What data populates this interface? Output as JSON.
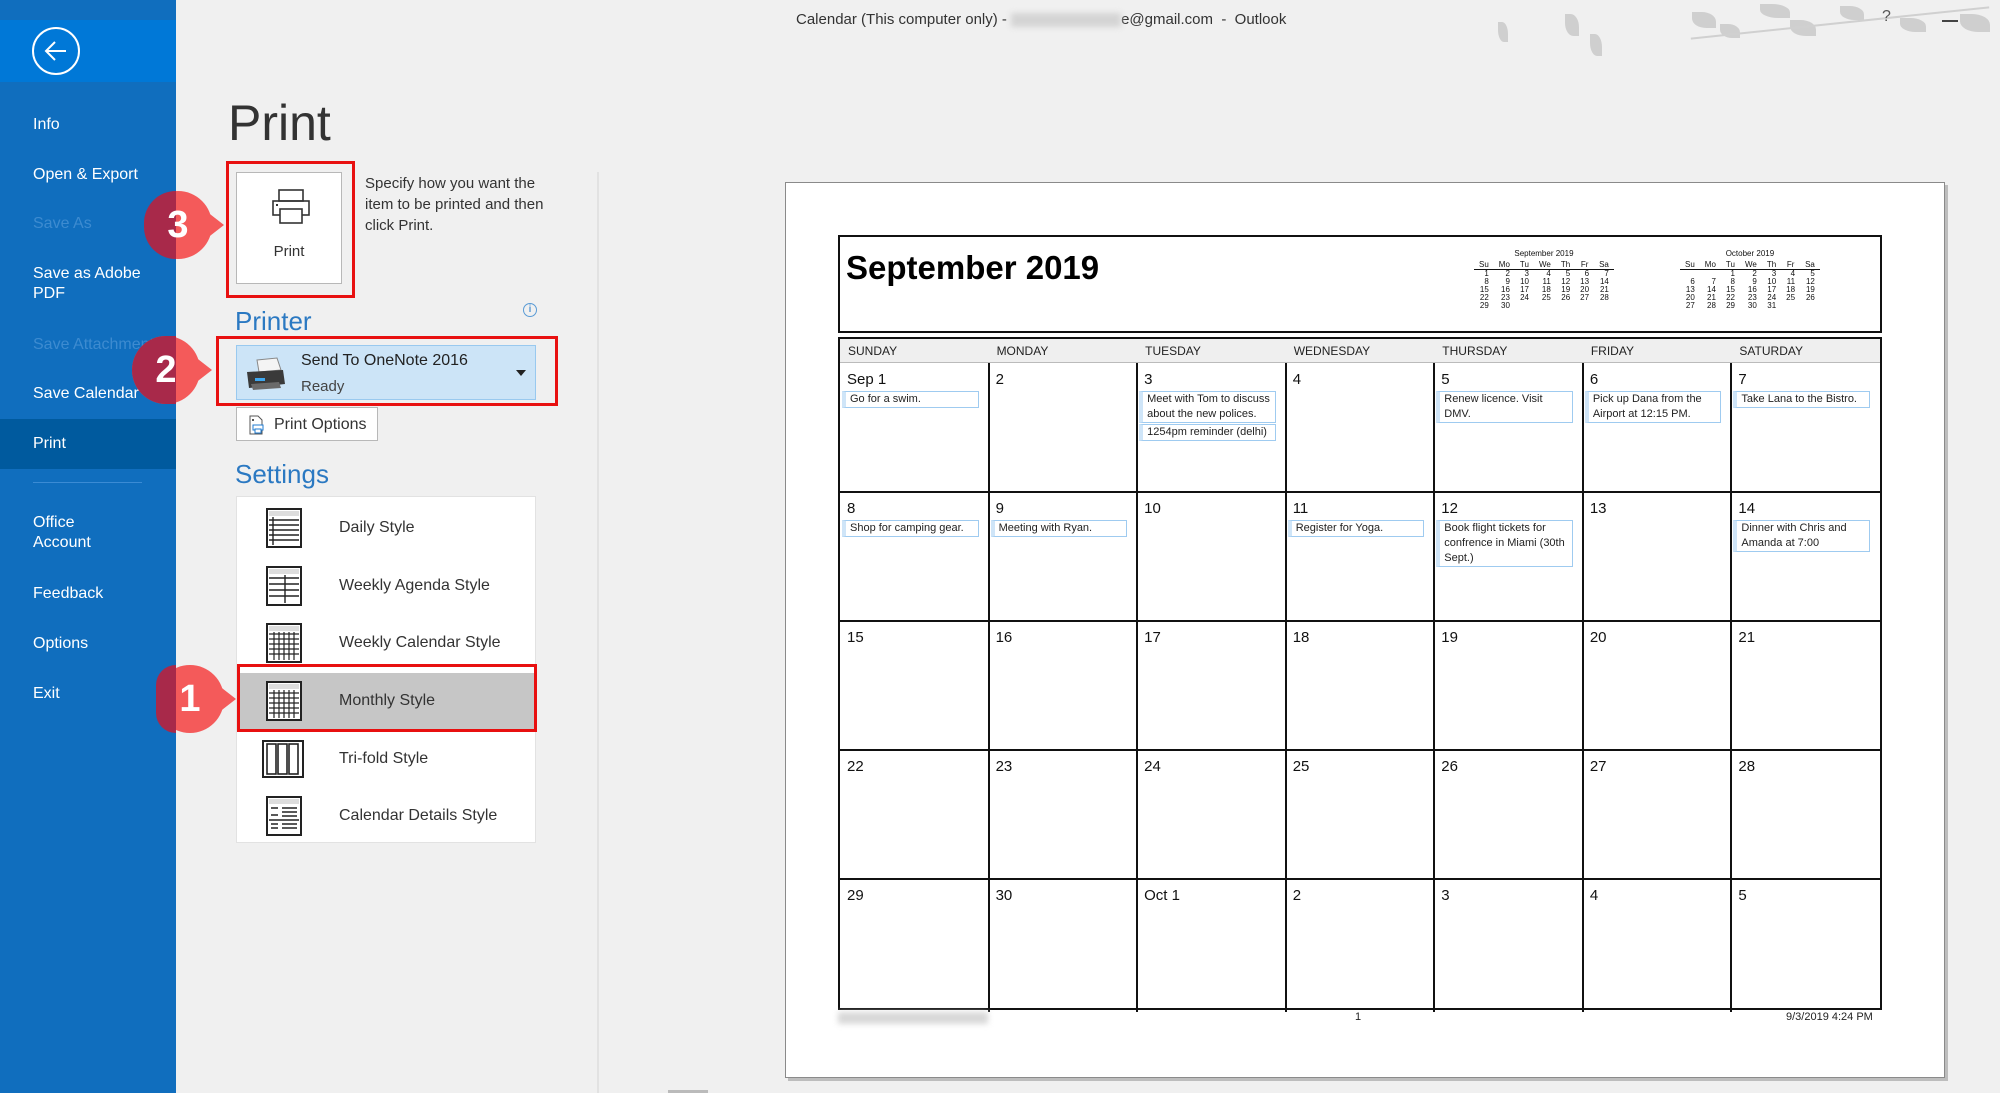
{
  "window": {
    "title_prefix": "Calendar (This computer only) - ",
    "title_email_visible": "e@gmail.com",
    "title_app": "  -  Outlook",
    "help_label": "?"
  },
  "sidebar": {
    "items": [
      {
        "label": "Info",
        "state": "normal"
      },
      {
        "label": "Open & Export",
        "state": "normal"
      },
      {
        "label": "Save As",
        "state": "disabled"
      },
      {
        "label": "Save as Adobe PDF",
        "state": "normal"
      },
      {
        "label": "Save Attachments",
        "state": "disabled"
      },
      {
        "label": "Save Calendar",
        "state": "normal"
      },
      {
        "label": "Print",
        "state": "active"
      },
      {
        "label": "Office Account",
        "state": "normal"
      },
      {
        "label": "Feedback",
        "state": "normal"
      },
      {
        "label": "Options",
        "state": "normal"
      },
      {
        "label": "Exit",
        "state": "normal"
      }
    ]
  },
  "print_panel": {
    "title": "Print",
    "print_button_label": "Print",
    "description": "Specify how you want the item to be printed and then click Print.",
    "printer_heading": "Printer",
    "printer_name": "Send To OneNote 2016",
    "printer_status": "Ready",
    "print_options_label": "Print Options",
    "settings_heading": "Settings",
    "styles": [
      {
        "label": "Daily Style",
        "icon": "daily-style-icon"
      },
      {
        "label": "Weekly Agenda Style",
        "icon": "weekly-agenda-style-icon"
      },
      {
        "label": "Weekly Calendar Style",
        "icon": "weekly-calendar-style-icon"
      },
      {
        "label": "Monthly Style",
        "icon": "monthly-style-icon",
        "selected": true
      },
      {
        "label": "Tri-fold Style",
        "icon": "trifold-style-icon"
      },
      {
        "label": "Calendar Details Style",
        "icon": "calendar-details-style-icon"
      }
    ]
  },
  "steps": {
    "one": "1",
    "two": "2",
    "three": "3"
  },
  "preview": {
    "month_title": "September 2019",
    "mini_calendars": [
      {
        "title": "September 2019",
        "days": [
          "Su",
          "Mo",
          "Tu",
          "We",
          "Th",
          "Fr",
          "Sa"
        ],
        "weeks": [
          [
            "1",
            "2",
            "3",
            "4",
            "5",
            "6",
            "7"
          ],
          [
            "8",
            "9",
            "10",
            "11",
            "12",
            "13",
            "14"
          ],
          [
            "15",
            "16",
            "17",
            "18",
            "19",
            "20",
            "21"
          ],
          [
            "22",
            "23",
            "24",
            "25",
            "26",
            "27",
            "28"
          ],
          [
            "29",
            "30",
            "",
            "",
            "",
            "",
            ""
          ]
        ]
      },
      {
        "title": "October 2019",
        "days": [
          "Su",
          "Mo",
          "Tu",
          "We",
          "Th",
          "Fr",
          "Sa"
        ],
        "weeks": [
          [
            "",
            "",
            "1",
            "2",
            "3",
            "4",
            "5"
          ],
          [
            "6",
            "7",
            "8",
            "9",
            "10",
            "11",
            "12"
          ],
          [
            "13",
            "14",
            "15",
            "16",
            "17",
            "18",
            "19"
          ],
          [
            "20",
            "21",
            "22",
            "23",
            "24",
            "25",
            "26"
          ],
          [
            "27",
            "28",
            "29",
            "30",
            "31",
            "",
            ""
          ]
        ]
      }
    ],
    "weekdays": [
      "SUNDAY",
      "MONDAY",
      "TUESDAY",
      "WEDNESDAY",
      "THURSDAY",
      "FRIDAY",
      "SATURDAY"
    ],
    "weeks": [
      [
        {
          "label": "Sep 1",
          "events": [
            "Go for a swim."
          ]
        },
        {
          "label": "2",
          "events": []
        },
        {
          "label": "3",
          "events": [
            "Meet with Tom to discuss about the new polices.",
            "1254pm reminder (delhi)"
          ]
        },
        {
          "label": "4",
          "events": []
        },
        {
          "label": "5",
          "events": [
            "Renew licence.  Visit DMV."
          ]
        },
        {
          "label": "6",
          "events": [
            "Pick up Dana from the Airport at 12:15 PM."
          ]
        },
        {
          "label": "7",
          "events": [
            "Take Lana to the Bistro."
          ]
        }
      ],
      [
        {
          "label": "8",
          "events": [
            "Shop for camping gear."
          ]
        },
        {
          "label": "9",
          "events": [
            "Meeting with Ryan."
          ]
        },
        {
          "label": "10",
          "events": []
        },
        {
          "label": "11",
          "events": [
            "Register for Yoga."
          ]
        },
        {
          "label": "12",
          "events": [
            "Book flight tickets for confrence in Miami (30th Sept.)"
          ]
        },
        {
          "label": "13",
          "events": []
        },
        {
          "label": "14",
          "events": [
            "Dinner with Chris and Amanda at 7:00"
          ]
        }
      ],
      [
        {
          "label": "15",
          "events": []
        },
        {
          "label": "16",
          "events": []
        },
        {
          "label": "17",
          "events": []
        },
        {
          "label": "18",
          "events": []
        },
        {
          "label": "19",
          "events": []
        },
        {
          "label": "20",
          "events": []
        },
        {
          "label": "21",
          "events": []
        }
      ],
      [
        {
          "label": "22",
          "events": []
        },
        {
          "label": "23",
          "events": []
        },
        {
          "label": "24",
          "events": []
        },
        {
          "label": "25",
          "events": []
        },
        {
          "label": "26",
          "events": []
        },
        {
          "label": "27",
          "events": []
        },
        {
          "label": "28",
          "events": []
        }
      ],
      [
        {
          "label": "29",
          "events": []
        },
        {
          "label": "30",
          "events": []
        },
        {
          "label": "Oct 1",
          "events": []
        },
        {
          "label": "2",
          "events": []
        },
        {
          "label": "3",
          "events": []
        },
        {
          "label": "4",
          "events": []
        },
        {
          "label": "5",
          "events": []
        }
      ]
    ],
    "footer_page": "1",
    "footer_datetime": "9/3/2019 4:24 PM"
  },
  "colors": {
    "sidebar_bg": "#106ebe",
    "sidebar_active": "#005a9e",
    "accent_heading": "#2b79c2",
    "highlight_box": "#e81010",
    "step_marker": "#f45a5a",
    "printer_select_bg": "#cce4f7",
    "selected_style_bg": "#c6c6c6"
  }
}
